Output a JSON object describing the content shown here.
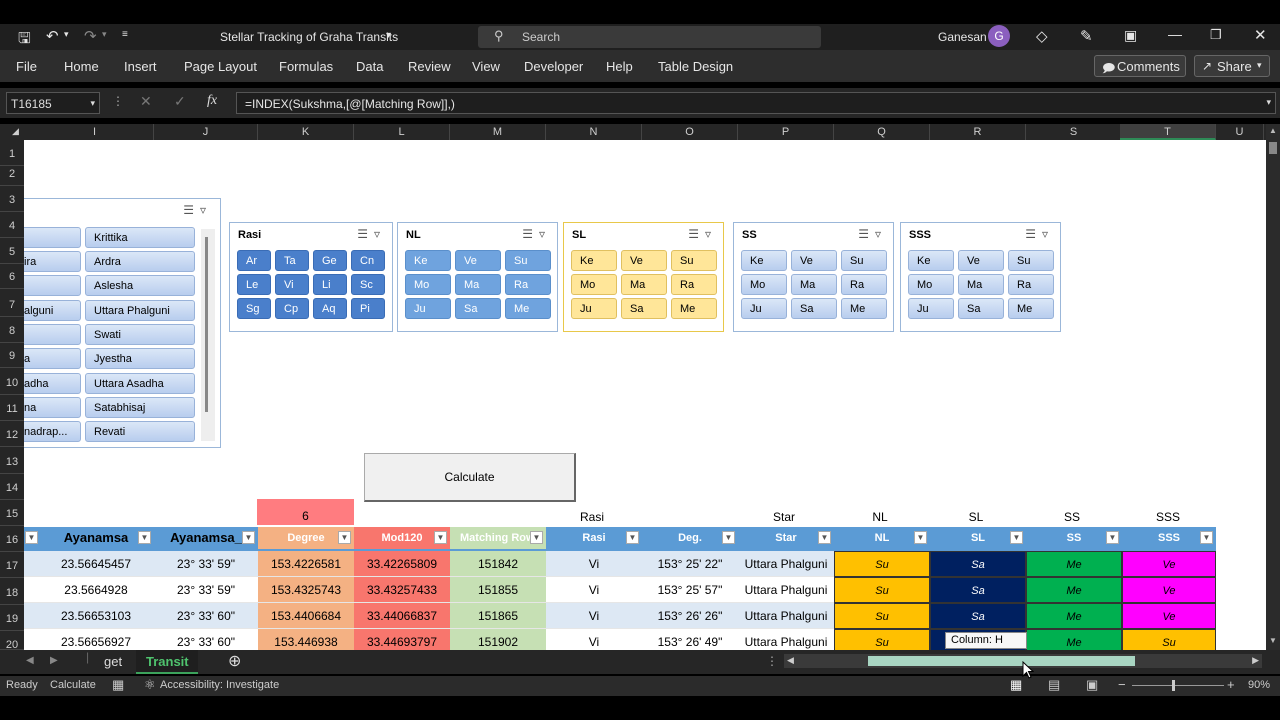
{
  "window": {
    "title": "Stellar Tracking of  Graha Transits",
    "search_placeholder": "Search",
    "user": "Ganesan",
    "user_initial": "G"
  },
  "menu": {
    "items": [
      "File",
      "Home",
      "Insert",
      "Page Layout",
      "Formulas",
      "Data",
      "Review",
      "View",
      "Developer",
      "Help",
      "Table Design"
    ],
    "comments": "Comments",
    "share": "Share"
  },
  "formula": {
    "namebox": "T16185",
    "content": "=INDEX(Sukshma,[@[Matching Row]],)",
    "fx": "fx"
  },
  "columns": [
    "I",
    "J",
    "K",
    "L",
    "M",
    "N",
    "O",
    "P",
    "Q",
    "R",
    "S",
    "T",
    "U"
  ],
  "rows": [
    "1",
    "2",
    "3",
    "4",
    "5",
    "6",
    "7",
    "8",
    "9",
    "10",
    "11",
    "12",
    "13",
    "14",
    "15",
    "16",
    "17",
    "18",
    "19",
    "20"
  ],
  "star_slicer": {
    "left": [
      "",
      "ira",
      "",
      "alguni",
      "",
      "a",
      "adha",
      "na",
      "nadrap..."
    ],
    "right": [
      "Krittika",
      "Ardra",
      "Aslesha",
      "Uttara Phalguni",
      "Swati",
      "Jyestha",
      "Uttara Asadha",
      "Satabhisaj",
      "Revati"
    ]
  },
  "slicers": {
    "rasi": {
      "title": "Rasi",
      "items": [
        "Ar",
        "Ta",
        "Ge",
        "Cn",
        "Le",
        "Vi",
        "Li",
        "Sc",
        "Sg",
        "Cp",
        "Aq",
        "Pi"
      ]
    },
    "nl": {
      "title": "NL",
      "items": [
        "Ke",
        "Ve",
        "Su",
        "Mo",
        "Ma",
        "Ra",
        "Ju",
        "Sa",
        "Me"
      ]
    },
    "sl": {
      "title": "SL",
      "items": [
        "Ke",
        "Ve",
        "Su",
        "Mo",
        "Ma",
        "Ra",
        "Ju",
        "Sa",
        "Me"
      ]
    },
    "ss": {
      "title": "SS",
      "items": [
        "Ke",
        "Ve",
        "Su",
        "Mo",
        "Ma",
        "Ra",
        "Ju",
        "Sa",
        "Me"
      ]
    },
    "sss": {
      "title": "SSS",
      "items": [
        "Ke",
        "Ve",
        "Su",
        "Mo",
        "Ma",
        "Ra",
        "Ju",
        "Sa",
        "Me"
      ]
    }
  },
  "calculate_button": "Calculate",
  "row15": {
    "k": "6",
    "n": "Rasi",
    "p": "Star",
    "q": "NL",
    "r": "SL",
    "s": "SS",
    "t": "SSS"
  },
  "table": {
    "headers": [
      "Ayanamsa",
      "Ayanamsa_",
      "Degree",
      "Mod120",
      "Matching Row",
      "Rasi",
      "Deg.",
      "Star",
      "NL",
      "SL",
      "SS",
      "SSS"
    ],
    "rows": [
      [
        "23.56645457",
        "23° 33' 59\"",
        "153.4226581",
        "33.42265809",
        "151842",
        "Vi",
        "153° 25' 22\"",
        "Uttara Phalguni",
        "Su",
        "Sa",
        "Me",
        "Ve"
      ],
      [
        "23.5664928",
        "23° 33' 59\"",
        "153.4325743",
        "33.43257433",
        "151855",
        "Vi",
        "153° 25' 57\"",
        "Uttara Phalguni",
        "Su",
        "Sa",
        "Me",
        "Ve"
      ],
      [
        "23.56653103",
        "23° 33' 60\"",
        "153.4406684",
        "33.44066837",
        "151865",
        "Vi",
        "153° 26' 26\"",
        "Uttara Phalguni",
        "Su",
        "Sa",
        "Me",
        "Ve"
      ],
      [
        "23.56656927",
        "23° 33' 60\"",
        "153.446938",
        "33.44693797",
        "151902",
        "Vi",
        "153° 26' 49\"",
        "Uttara Phalguni",
        "Su",
        "",
        "Me",
        "Su"
      ]
    ]
  },
  "tooltip": "Column: H",
  "tabs": {
    "items": [
      "get",
      "Transit"
    ],
    "active": "Transit"
  },
  "status": {
    "ready": "Ready",
    "calculate": "Calculate",
    "accessibility": "Accessibility: Investigate",
    "zoom": "90%"
  },
  "colors": {
    "nl": "#ffc000",
    "sl": "#002060",
    "ss": "#00b050",
    "sss": "#ff00ff",
    "degree": "#f4b183",
    "mod120": "#f8766d",
    "matching": "#c6e0b4",
    "tablehdr": "#5b9bd5",
    "row15k": "#ff7c80"
  }
}
